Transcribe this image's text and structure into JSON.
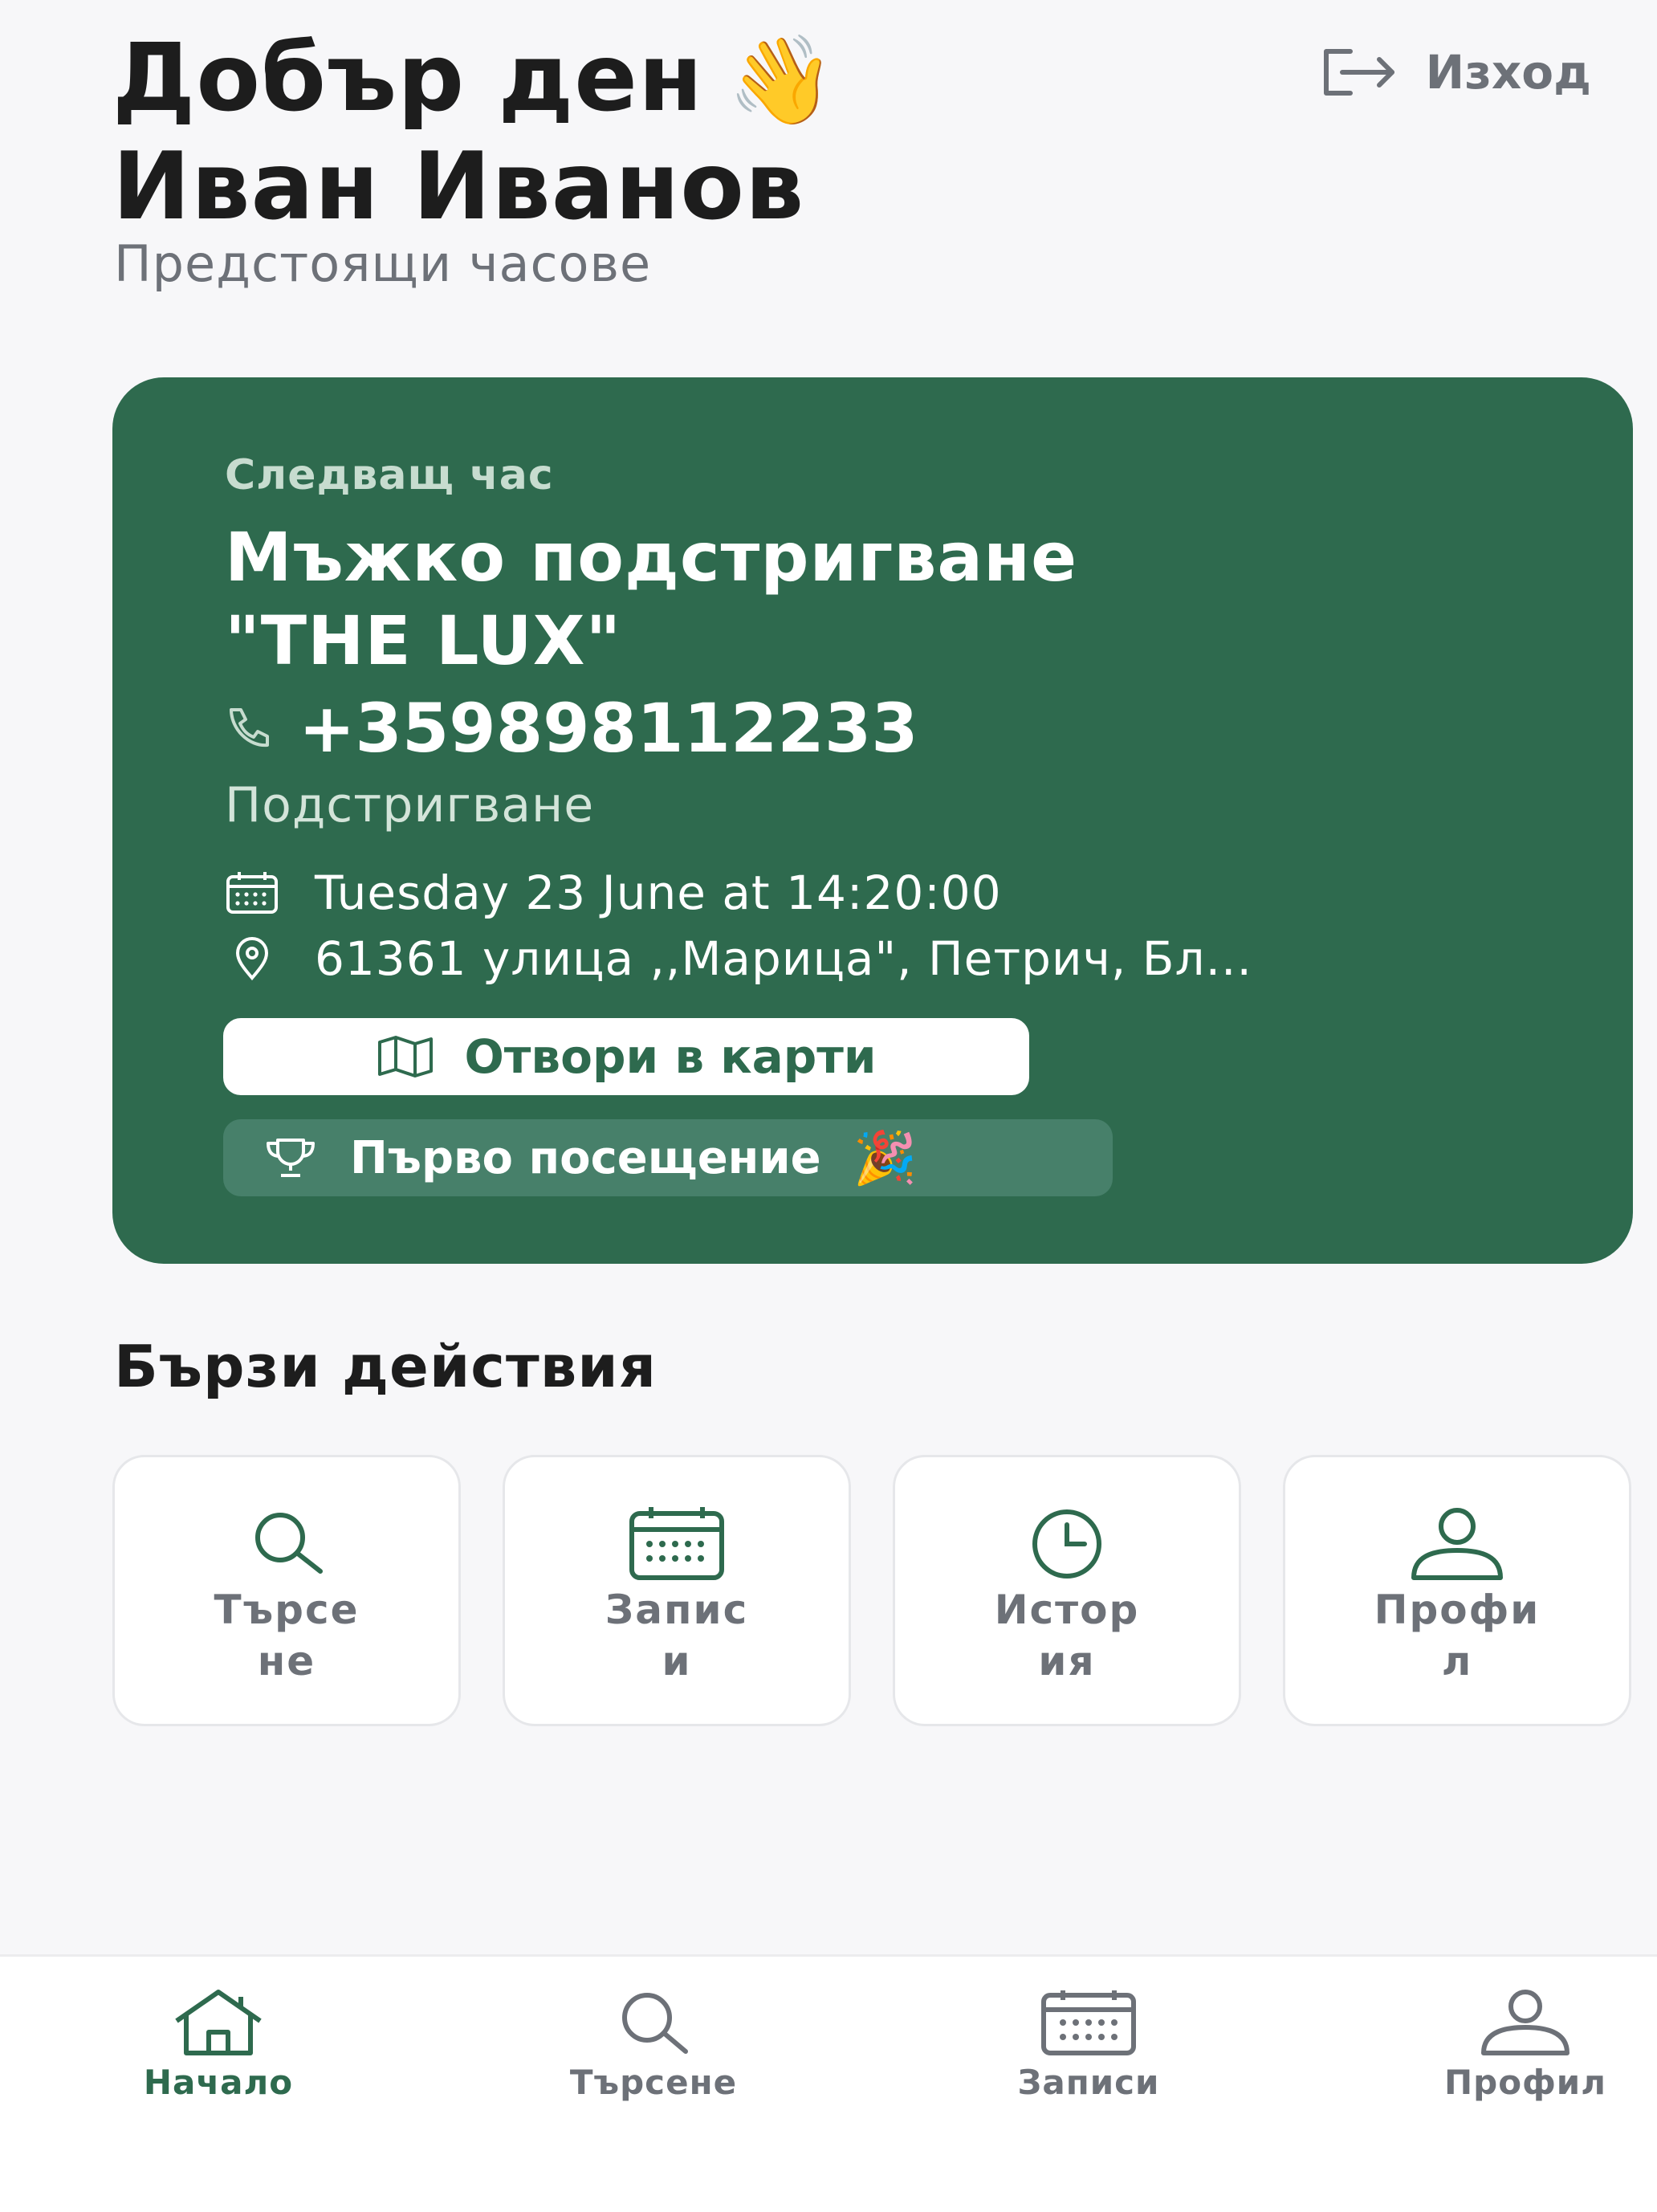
{
  "header": {
    "greeting_line1": "Добър ден",
    "greeting_emoji": "👋",
    "greeting_line2": "Иван Иванов",
    "subtitle": "Предстоящи часове",
    "logout_label": "Изход",
    "logout_icon": "logout-icon"
  },
  "next_appointment": {
    "label": "Следващ час",
    "title_line1": "Мъжко подстригване",
    "title_line2": "\"THE LUX\"",
    "phone": "+359898112233",
    "phone_icon": "phone-icon",
    "service": "Подстригване",
    "datetime": "Tuesday 23 June at 14:20:00",
    "date_icon": "calendar-icon",
    "address": "61361 улица ,,Марица\", Петрич, Бл...",
    "address_icon": "location-pin-icon",
    "map_button_label": "Отвори в карти",
    "map_icon": "map-icon",
    "badge_label": "Първо посещение",
    "badge_emoji": "🎉",
    "badge_icon": "trophy-icon"
  },
  "quick_actions": {
    "title": "Бързи действия",
    "items": [
      {
        "line1": "Търсе",
        "line2": "не",
        "icon": "search-icon"
      },
      {
        "line1": "Запис",
        "line2": "и",
        "icon": "calendar-icon"
      },
      {
        "line1": "Истор",
        "line2": "ия",
        "icon": "clock-icon"
      },
      {
        "line1": "Профи",
        "line2": "л",
        "icon": "user-icon"
      }
    ]
  },
  "bottom_nav": {
    "items": [
      {
        "label": "Начало",
        "icon": "home-icon",
        "active": true
      },
      {
        "label": "Търсене",
        "icon": "search-icon",
        "active": false
      },
      {
        "label": "Записи",
        "icon": "calendar-icon",
        "active": false
      },
      {
        "label": "Профил",
        "icon": "user-icon",
        "active": false
      }
    ]
  },
  "colors": {
    "accent": "#2e6a4e",
    "card_badge": "#47806a",
    "muted_text": "#6d7178",
    "background": "#f7f7f9"
  }
}
